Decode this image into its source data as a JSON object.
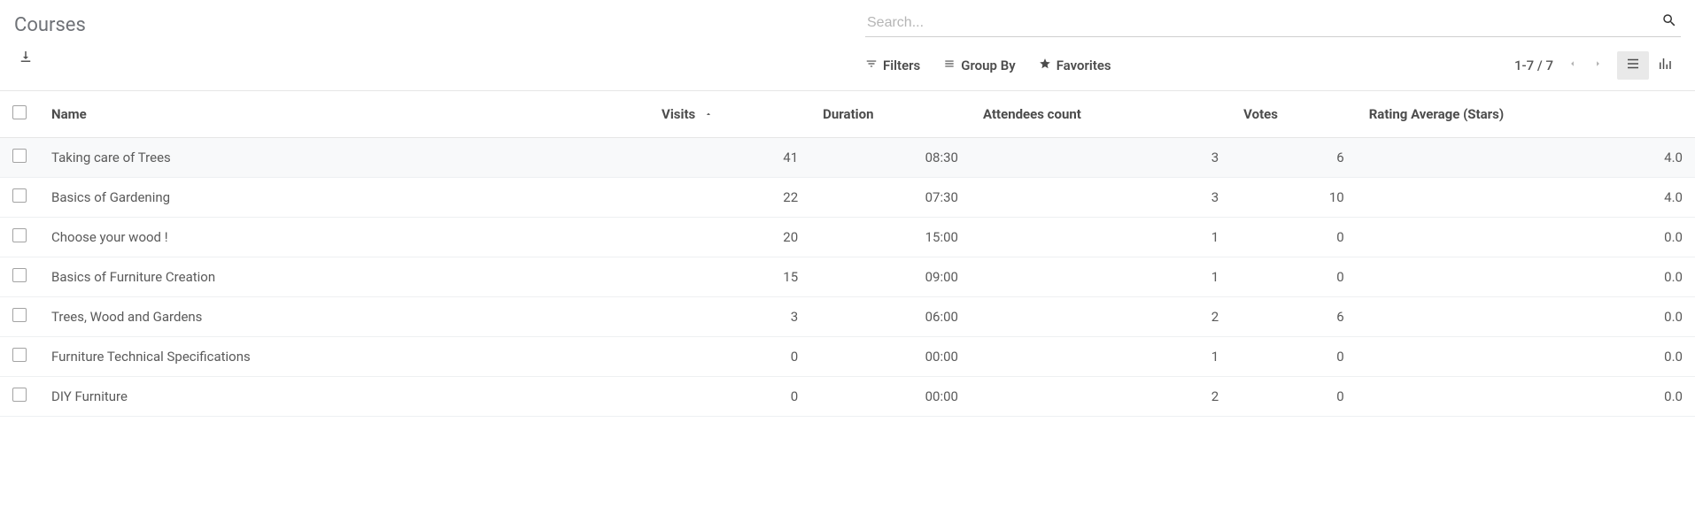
{
  "page_title": "Courses",
  "search": {
    "placeholder": "Search..."
  },
  "toolbar": {
    "filters_label": "Filters",
    "groupby_label": "Group By",
    "favorites_label": "Favorites"
  },
  "pager": {
    "text": "1-7 / 7"
  },
  "columns": {
    "name": "Name",
    "visits": "Visits",
    "duration": "Duration",
    "attendees": "Attendees count",
    "votes": "Votes",
    "rating": "Rating Average (Stars)"
  },
  "sort": {
    "column": "visits",
    "dir": "asc"
  },
  "rows": [
    {
      "name": "Taking care of Trees",
      "visits": "41",
      "duration": "08:30",
      "attendees": "3",
      "votes": "6",
      "rating": "4.0"
    },
    {
      "name": "Basics of Gardening",
      "visits": "22",
      "duration": "07:30",
      "attendees": "3",
      "votes": "10",
      "rating": "4.0"
    },
    {
      "name": "Choose your wood !",
      "visits": "20",
      "duration": "15:00",
      "attendees": "1",
      "votes": "0",
      "rating": "0.0"
    },
    {
      "name": "Basics of Furniture Creation",
      "visits": "15",
      "duration": "09:00",
      "attendees": "1",
      "votes": "0",
      "rating": "0.0"
    },
    {
      "name": "Trees, Wood and Gardens",
      "visits": "3",
      "duration": "06:00",
      "attendees": "2",
      "votes": "6",
      "rating": "0.0"
    },
    {
      "name": "Furniture Technical Specifications",
      "visits": "0",
      "duration": "00:00",
      "attendees": "1",
      "votes": "0",
      "rating": "0.0"
    },
    {
      "name": "DIY Furniture",
      "visits": "0",
      "duration": "00:00",
      "attendees": "2",
      "votes": "0",
      "rating": "0.0"
    }
  ]
}
